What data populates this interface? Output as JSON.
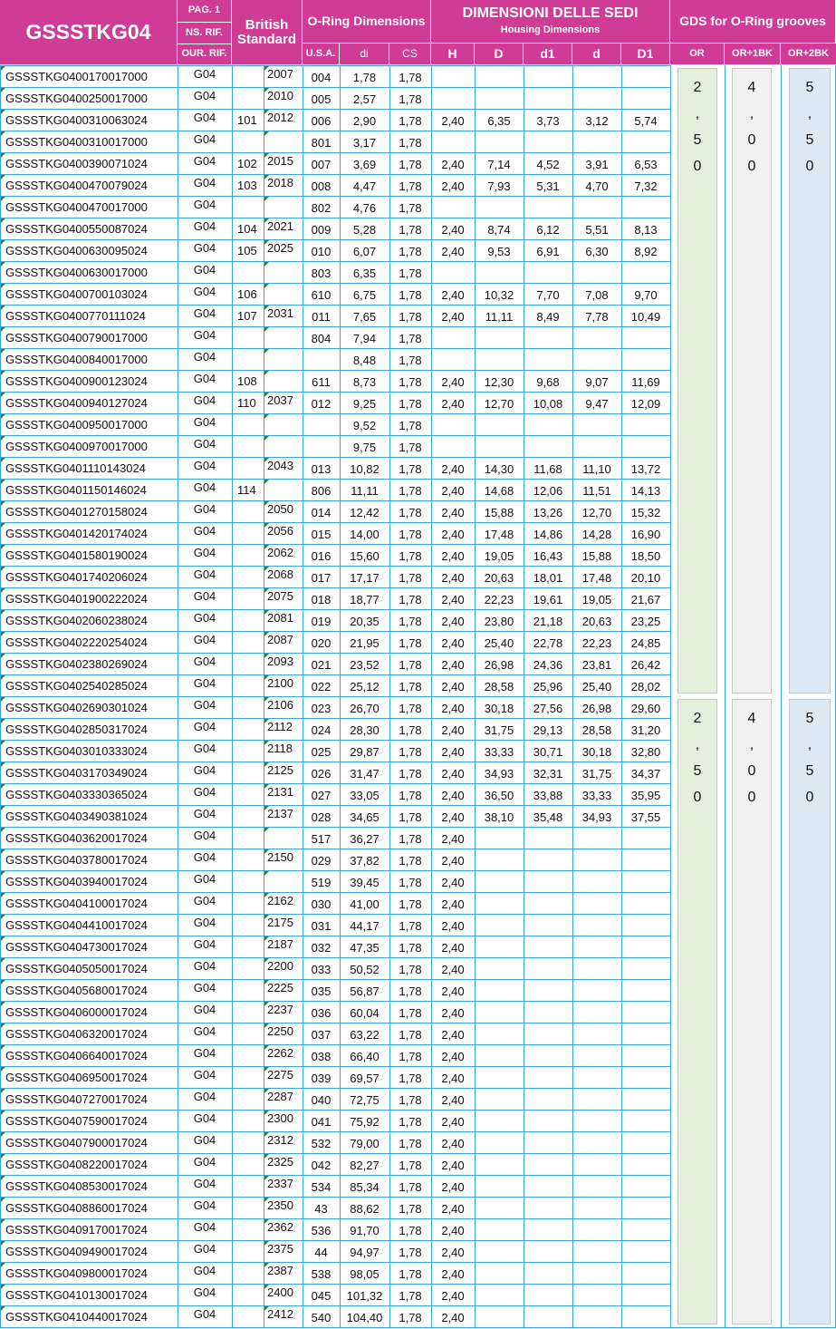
{
  "header": {
    "code": "GSSSTKG04",
    "pag": "PAG. 1",
    "ns_rif": "NS. RIF.",
    "our_rif": "OUR. RIF.",
    "british": "British Standard",
    "oring": "O-Ring Dimensions",
    "usa": "U.S.A.",
    "di": "di",
    "cs": "CS",
    "housing_title": "DIMENSIONI DELLE SEDI",
    "housing_sub": "Housing Dimensions",
    "H": "H",
    "D": "D",
    "d1": "d1",
    "d": "d",
    "D1": "D1",
    "gds_title": "GDS for O-Ring grooves",
    "or": "OR",
    "or1bk": "OR+1BK",
    "or2bk": "OR+2BK"
  },
  "gds": [
    {
      "or": [
        "2",
        ",",
        "5",
        "0"
      ],
      "or1bk": [
        "4",
        ",",
        "0",
        "0"
      ],
      "or2bk": [
        "5",
        ",",
        "5",
        "0"
      ]
    },
    {
      "or": [
        "2",
        ",",
        "5",
        "0"
      ],
      "or1bk": [
        "4",
        ",",
        "0",
        "0"
      ],
      "or2bk": [
        "5",
        ",",
        "5",
        "0"
      ]
    }
  ],
  "rows": [
    [
      "GSSSTKG0400170017000",
      "G04",
      "",
      "2007",
      "004",
      "1,78",
      "1,78",
      "",
      "",
      "",
      "",
      ""
    ],
    [
      "GSSSTKG0400250017000",
      "G04",
      "",
      "2010",
      "005",
      "2,57",
      "1,78",
      "",
      "",
      "",
      "",
      ""
    ],
    [
      "GSSSTKG0400310063024",
      "G04",
      "101",
      "2012",
      "006",
      "2,90",
      "1,78",
      "2,40",
      "6,35",
      "3,73",
      "3,12",
      "5,74"
    ],
    [
      "GSSSTKG0400310017000",
      "G04",
      "",
      "",
      "801",
      "3,17",
      "1,78",
      "",
      "",
      "",
      "",
      ""
    ],
    [
      "GSSSTKG0400390071024",
      "G04",
      "102",
      "2015",
      "007",
      "3,69",
      "1,78",
      "2,40",
      "7,14",
      "4,52",
      "3,91",
      "6,53"
    ],
    [
      "GSSSTKG0400470079024",
      "G04",
      "103",
      "2018",
      "008",
      "4,47",
      "1,78",
      "2,40",
      "7,93",
      "5,31",
      "4,70",
      "7,32"
    ],
    [
      "GSSSTKG0400470017000",
      "G04",
      "",
      "",
      "802",
      "4,76",
      "1,78",
      "",
      "",
      "",
      "",
      ""
    ],
    [
      "GSSSTKG0400550087024",
      "G04",
      "104",
      "2021",
      "009",
      "5,28",
      "1,78",
      "2,40",
      "8,74",
      "6,12",
      "5,51",
      "8,13"
    ],
    [
      "GSSSTKG0400630095024",
      "G04",
      "105",
      "2025",
      "010",
      "6,07",
      "1,78",
      "2,40",
      "9,53",
      "6,91",
      "6,30",
      "8,92"
    ],
    [
      "GSSSTKG0400630017000",
      "G04",
      "",
      "",
      "803",
      "6,35",
      "1,78",
      "",
      "",
      "",
      "",
      ""
    ],
    [
      "GSSSTKG0400700103024",
      "G04",
      "106",
      "",
      "610",
      "6,75",
      "1,78",
      "2,40",
      "10,32",
      "7,70",
      "7,08",
      "9,70"
    ],
    [
      "GSSSTKG0400770111024",
      "G04",
      "107",
      "2031",
      "011",
      "7,65",
      "1,78",
      "2,40",
      "11,11",
      "8,49",
      "7,78",
      "10,49"
    ],
    [
      "GSSSTKG0400790017000",
      "G04",
      "",
      "",
      "804",
      "7,94",
      "1,78",
      "",
      "",
      "",
      "",
      ""
    ],
    [
      "GSSSTKG0400840017000",
      "G04",
      "",
      "",
      "",
      "8,48",
      "1,78",
      "",
      "",
      "",
      "",
      ""
    ],
    [
      "GSSSTKG0400900123024",
      "G04",
      "108",
      "",
      "611",
      "8,73",
      "1,78",
      "2,40",
      "12,30",
      "9,68",
      "9,07",
      "11,69"
    ],
    [
      "GSSSTKG0400940127024",
      "G04",
      "110",
      "2037",
      "012",
      "9,25",
      "1,78",
      "2,40",
      "12,70",
      "10,08",
      "9,47",
      "12,09"
    ],
    [
      "GSSSTKG0400950017000",
      "G04",
      "",
      "",
      "",
      "9,52",
      "1,78",
      "",
      "",
      "",
      "",
      ""
    ],
    [
      "GSSSTKG0400970017000",
      "G04",
      "",
      "",
      "",
      "9,75",
      "1,78",
      "",
      "",
      "",
      "",
      ""
    ],
    [
      "GSSSTKG0401110143024",
      "G04",
      "",
      "2043",
      "013",
      "10,82",
      "1,78",
      "2,40",
      "14,30",
      "11,68",
      "11,10",
      "13,72"
    ],
    [
      "GSSSTKG0401150146024",
      "G04",
      "114",
      "",
      "806",
      "11,11",
      "1,78",
      "2,40",
      "14,68",
      "12,06",
      "11,51",
      "14,13"
    ],
    [
      "GSSSTKG0401270158024",
      "G04",
      "",
      "2050",
      "014",
      "12,42",
      "1,78",
      "2,40",
      "15,88",
      "13,26",
      "12,70",
      "15,32"
    ],
    [
      "GSSSTKG0401420174024",
      "G04",
      "",
      "2056",
      "015",
      "14,00",
      "1,78",
      "2,40",
      "17,48",
      "14,86",
      "14,28",
      "16,90"
    ],
    [
      "GSSSTKG0401580190024",
      "G04",
      "",
      "2062",
      "016",
      "15,60",
      "1,78",
      "2,40",
      "19,05",
      "16,43",
      "15,88",
      "18,50"
    ],
    [
      "GSSSTKG0401740206024",
      "G04",
      "",
      "2068",
      "017",
      "17,17",
      "1,78",
      "2,40",
      "20,63",
      "18,01",
      "17,48",
      "20,10"
    ],
    [
      "GSSSTKG0401900222024",
      "G04",
      "",
      "2075",
      "018",
      "18,77",
      "1,78",
      "2,40",
      "22,23",
      "19,61",
      "19,05",
      "21,67"
    ],
    [
      "GSSSTKG0402060238024",
      "G04",
      "",
      "2081",
      "019",
      "20,35",
      "1,78",
      "2,40",
      "23,80",
      "21,18",
      "20,63",
      "23,25"
    ],
    [
      "GSSSTKG0402220254024",
      "G04",
      "",
      "2087",
      "020",
      "21,95",
      "1,78",
      "2,40",
      "25,40",
      "22,78",
      "22,23",
      "24,85"
    ],
    [
      "GSSSTKG0402380269024",
      "G04",
      "",
      "2093",
      "021",
      "23,52",
      "1,78",
      "2,40",
      "26,98",
      "24,36",
      "23,81",
      "26,42"
    ],
    [
      "GSSSTKG0402540285024",
      "G04",
      "",
      "2100",
      "022",
      "25,12",
      "1,78",
      "2,40",
      "28,58",
      "25,96",
      "25,40",
      "28,02"
    ],
    [
      "GSSSTKG0402690301024",
      "G04",
      "",
      "2106",
      "023",
      "26,70",
      "1,78",
      "2,40",
      "30,18",
      "27,56",
      "26,98",
      "29,60"
    ],
    [
      "GSSSTKG0402850317024",
      "G04",
      "",
      "2112",
      "024",
      "28,30",
      "1,78",
      "2,40",
      "31,75",
      "29,13",
      "28,58",
      "31,20"
    ],
    [
      "GSSSTKG0403010333024",
      "G04",
      "",
      "2118",
      "025",
      "29,87",
      "1,78",
      "2,40",
      "33,33",
      "30,71",
      "30,18",
      "32,80"
    ],
    [
      "GSSSTKG0403170349024",
      "G04",
      "",
      "2125",
      "026",
      "31,47",
      "1,78",
      "2,40",
      "34,93",
      "32,31",
      "31,75",
      "34,37"
    ],
    [
      "GSSSTKG0403330365024",
      "G04",
      "",
      "2131",
      "027",
      "33,05",
      "1,78",
      "2,40",
      "36,50",
      "33,88",
      "33,33",
      "35,95"
    ],
    [
      "GSSSTKG0403490381024",
      "G04",
      "",
      "2137",
      "028",
      "34,65",
      "1,78",
      "2,40",
      "38,10",
      "35,48",
      "34,93",
      "37,55"
    ],
    [
      "GSSSTKG0403620017024",
      "G04",
      "",
      "",
      "517",
      "36,27",
      "1,78",
      "2,40",
      "",
      "",
      "",
      ""
    ],
    [
      "GSSSTKG0403780017024",
      "G04",
      "",
      "2150",
      "029",
      "37,82",
      "1,78",
      "2,40",
      "",
      "",
      "",
      ""
    ],
    [
      "GSSSTKG0403940017024",
      "G04",
      "",
      "",
      "519",
      "39,45",
      "1,78",
      "2,40",
      "",
      "",
      "",
      ""
    ],
    [
      "GSSSTKG0404100017024",
      "G04",
      "",
      "2162",
      "030",
      "41,00",
      "1,78",
      "2,40",
      "",
      "",
      "",
      ""
    ],
    [
      "GSSSTKG0404410017024",
      "G04",
      "",
      "2175",
      "031",
      "44,17",
      "1,78",
      "2,40",
      "",
      "",
      "",
      ""
    ],
    [
      "GSSSTKG0404730017024",
      "G04",
      "",
      "2187",
      "032",
      "47,35",
      "1,78",
      "2,40",
      "",
      "",
      "",
      ""
    ],
    [
      "GSSSTKG0405050017024",
      "G04",
      "",
      "2200",
      "033",
      "50,52",
      "1,78",
      "2,40",
      "",
      "",
      "",
      ""
    ],
    [
      "GSSSTKG0405680017024",
      "G04",
      "",
      "2225",
      "035",
      "56,87",
      "1,78",
      "2,40",
      "",
      "",
      "",
      ""
    ],
    [
      "GSSSTKG0406000017024",
      "G04",
      "",
      "2237",
      "036",
      "60,04",
      "1,78",
      "2,40",
      "",
      "",
      "",
      ""
    ],
    [
      "GSSSTKG0406320017024",
      "G04",
      "",
      "2250",
      "037",
      "63,22",
      "1,78",
      "2,40",
      "",
      "",
      "",
      ""
    ],
    [
      "GSSSTKG0406640017024",
      "G04",
      "",
      "2262",
      "038",
      "66,40",
      "1,78",
      "2,40",
      "",
      "",
      "",
      ""
    ],
    [
      "GSSSTKG0406950017024",
      "G04",
      "",
      "2275",
      "039",
      "69,57",
      "1,78",
      "2,40",
      "",
      "",
      "",
      ""
    ],
    [
      "GSSSTKG0407270017024",
      "G04",
      "",
      "2287",
      "040",
      "72,75",
      "1,78",
      "2,40",
      "",
      "",
      "",
      ""
    ],
    [
      "GSSSTKG0407590017024",
      "G04",
      "",
      "2300",
      "041",
      "75,92",
      "1,78",
      "2,40",
      "",
      "",
      "",
      ""
    ],
    [
      "GSSSTKG0407900017024",
      "G04",
      "",
      "2312",
      "532",
      "79,00",
      "1,78",
      "2,40",
      "",
      "",
      "",
      ""
    ],
    [
      "GSSSTKG0408220017024",
      "G04",
      "",
      "2325",
      "042",
      "82,27",
      "1,78",
      "2,40",
      "",
      "",
      "",
      ""
    ],
    [
      "GSSSTKG0408530017024",
      "G04",
      "",
      "2337",
      "534",
      "85,34",
      "1,78",
      "2,40",
      "",
      "",
      "",
      ""
    ],
    [
      "GSSSTKG0408860017024",
      "G04",
      "",
      "2350",
      "43",
      "88,62",
      "1,78",
      "2,40",
      "",
      "",
      "",
      ""
    ],
    [
      "GSSSTKG0409170017024",
      "G04",
      "",
      "2362",
      "536",
      "91,70",
      "1,78",
      "2,40",
      "",
      "",
      "",
      ""
    ],
    [
      "GSSSTKG0409490017024",
      "G04",
      "",
      "2375",
      "44",
      "94,97",
      "1,78",
      "2,40",
      "",
      "",
      "",
      ""
    ],
    [
      "GSSSTKG0409800017024",
      "G04",
      "",
      "2387",
      "538",
      "98,05",
      "1,78",
      "2,40",
      "",
      "",
      "",
      ""
    ],
    [
      "GSSSTKG0410130017024",
      "G04",
      "",
      "2400",
      "045",
      "101,32",
      "1,78",
      "2,40",
      "",
      "",
      "",
      ""
    ],
    [
      "GSSSTKG0410440017024",
      "G04",
      "",
      "2412",
      "540",
      "104,40",
      "1,78",
      "2,40",
      "",
      "",
      "",
      ""
    ]
  ],
  "colors": {
    "header": "#d03b95",
    "grid": "#3aa6d6",
    "gds_or": "#e3efda",
    "gds_or1bk": "#f1f1f1",
    "gds_or2bk": "#dde9f5",
    "tick": "#2e8b3a"
  }
}
